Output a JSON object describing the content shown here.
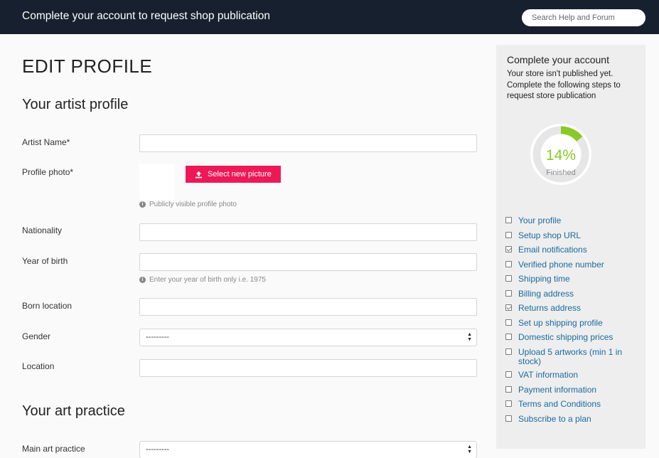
{
  "topbar": {
    "title": "Complete your account to request shop publication",
    "search_placeholder": "Search Help and Forum"
  },
  "page": {
    "title": "EDIT PROFILE"
  },
  "artist_profile": {
    "section_title": "Your artist profile",
    "fields": {
      "artist_name": {
        "label": "Artist Name*",
        "value": ""
      },
      "profile_photo": {
        "label": "Profile photo*",
        "button_label": "Select new picture",
        "hint": "Publicly visible profile photo"
      },
      "nationality": {
        "label": "Nationality",
        "value": ""
      },
      "year_of_birth": {
        "label": "Year of birth",
        "value": "",
        "hint": "Enter your year of birth only i.e. 1975"
      },
      "born_location": {
        "label": "Born location",
        "value": ""
      },
      "gender": {
        "label": "Gender",
        "selected": "---------"
      },
      "location": {
        "label": "Location",
        "value": ""
      }
    }
  },
  "art_practice": {
    "section_title": "Your art practice",
    "fields": {
      "main_art_practice": {
        "label": "Main art practice",
        "selected": "---------"
      }
    }
  },
  "sidebar": {
    "title": "Complete your account",
    "description": "Your store isn't published yet. Complete the following steps to request store publication",
    "progress": {
      "percent_text": "14%",
      "value": 0.14,
      "label": "Finished"
    },
    "steps": [
      {
        "label": "Your profile",
        "checked": false
      },
      {
        "label": "Setup shop URL",
        "checked": false
      },
      {
        "label": "Email notifications",
        "checked": true
      },
      {
        "label": "Verified phone number",
        "checked": false
      },
      {
        "label": "Shipping time",
        "checked": false
      },
      {
        "label": "Billing address",
        "checked": false
      },
      {
        "label": "Returns address",
        "checked": true
      },
      {
        "label": "Set up shipping profile",
        "checked": false
      },
      {
        "label": "Domestic shipping prices",
        "checked": false
      },
      {
        "label": "Upload 5 artworks (min 1 in stock)",
        "checked": false
      },
      {
        "label": "VAT information",
        "checked": false
      },
      {
        "label": "Payment information",
        "checked": false
      },
      {
        "label": "Terms and Conditions",
        "checked": false
      },
      {
        "label": "Subscribe to a plan",
        "checked": false
      }
    ]
  },
  "colors": {
    "topbar_bg": "#16202e",
    "accent_button": "#ed1957",
    "progress_green": "#8ac926",
    "link_blue": "#1a6aa0"
  }
}
